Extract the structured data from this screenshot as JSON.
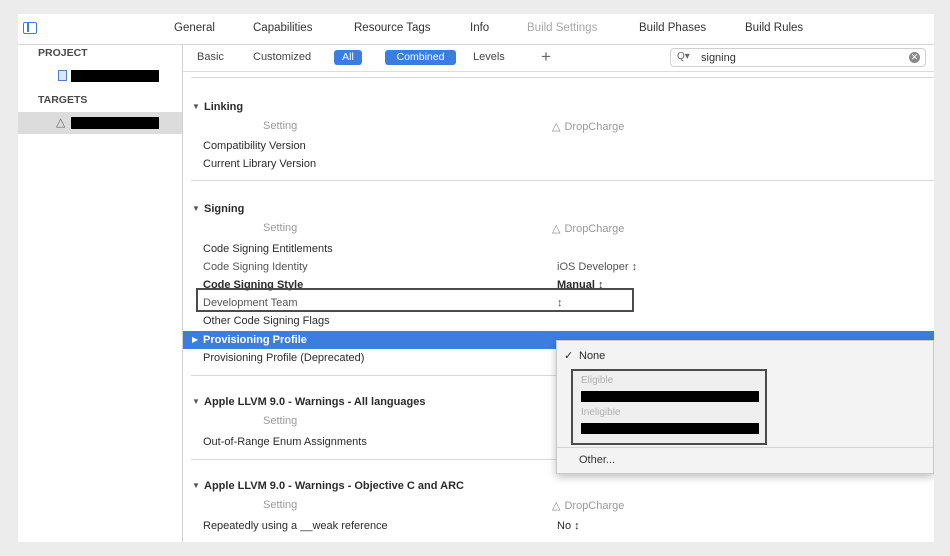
{
  "tabs": [
    "General",
    "Capabilities",
    "Resource Tags",
    "Info",
    "Build Settings",
    "Build Phases",
    "Build Rules"
  ],
  "active_tab": "Build Settings",
  "navigator": {
    "project_header": "PROJECT",
    "targets_header": "TARGETS"
  },
  "filter": {
    "basic": "Basic",
    "customized": "Customized",
    "all": "All",
    "combined": "Combined",
    "levels": "Levels",
    "add": "+",
    "search_value": "signing",
    "search_icon": "magnifier-icon",
    "clear_icon": "clear-circle-icon"
  },
  "sections": {
    "linking": {
      "title": "Linking",
      "setting_header": "Setting",
      "target_header": "DropCharge",
      "rows": [
        "Compatibility Version",
        "Current Library Version"
      ]
    },
    "signing": {
      "title": "Signing",
      "setting_header": "Setting",
      "target_header": "DropCharge",
      "entitlements": "Code Signing Entitlements",
      "identity": "Code Signing Identity",
      "identity_value": "iOS Developer ↕",
      "style": "Code Signing Style",
      "style_value": "Manual ↕",
      "team": "Development Team",
      "team_value": "↕",
      "other_flags": "Other Code Signing Flags",
      "profile": "Provisioning Profile",
      "profile_deprecated": "Provisioning Profile (Deprecated)"
    },
    "warnings_all": {
      "title": "Apple LLVM 9.0 - Warnings - All languages",
      "setting_header": "Setting",
      "row": "Out-of-Range Enum Assignments"
    },
    "warnings_objc": {
      "title": "Apple LLVM 9.0 - Warnings - Objective C and ARC",
      "setting_header": "Setting",
      "target_header": "DropCharge",
      "row": "Repeatedly using a __weak reference",
      "row_value": "No ↕"
    }
  },
  "popup": {
    "none_label": "None",
    "eligible_label": "Eligible",
    "ineligible_label": "Ineligible",
    "other_label": "Other..."
  },
  "colors": {
    "accent": "#3b7ee0",
    "selection": "#3b7ee0",
    "highlight_border": "#4b4b4b"
  }
}
